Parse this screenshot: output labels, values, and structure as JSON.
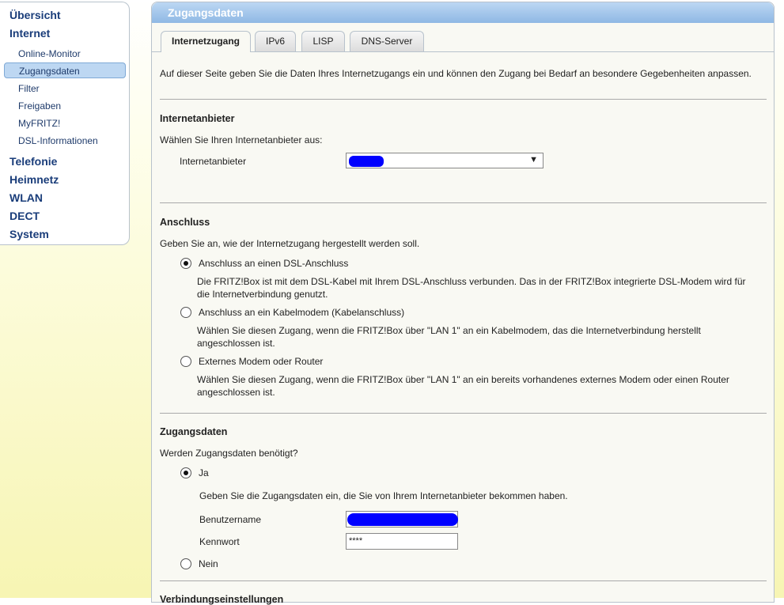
{
  "sidebar": {
    "main_top": [
      "Übersicht",
      "Internet"
    ],
    "sub": [
      "Online-Monitor",
      "Zugangsdaten",
      "Filter",
      "Freigaben",
      "MyFRITZ!",
      "DSL-Informationen"
    ],
    "main_bottom": [
      "Telefonie",
      "Heimnetz",
      "WLAN",
      "DECT",
      "System"
    ]
  },
  "page": {
    "title": "Zugangsdaten",
    "tabs": [
      "Internetzugang",
      "IPv6",
      "LISP",
      "DNS-Server"
    ],
    "intro": "Auf dieser Seite geben Sie die Daten Ihres Internetzugangs ein und können den Zugang bei Bedarf an besondere Gegebenheiten anpassen."
  },
  "provider": {
    "title": "Internetanbieter",
    "prompt": "Wählen Sie Ihren Internetanbieter aus:",
    "label": "Internetanbieter"
  },
  "connection": {
    "title": "Anschluss",
    "prompt": "Geben Sie an, wie der Internetzugang hergestellt werden soll.",
    "options": [
      {
        "label": "Anschluss an einen DSL-Anschluss",
        "desc": "Die FRITZ!Box ist mit dem DSL-Kabel mit Ihrem DSL-Anschluss verbunden. Das in der FRITZ!Box integrierte DSL-Modem wird für die Internetverbindung genutzt."
      },
      {
        "label": "Anschluss an ein Kabelmodem (Kabelanschluss)",
        "desc": "Wählen Sie diesen Zugang, wenn die FRITZ!Box über \"LAN 1\" an ein Kabelmodem, das die Internetverbindung herstellt angeschlossen ist."
      },
      {
        "label": "Externes Modem oder Router",
        "desc": "Wählen Sie diesen Zugang, wenn die FRITZ!Box über \"LAN 1\" an ein bereits vorhandenes externes Modem oder einen Router angeschlossen ist."
      }
    ]
  },
  "credentials": {
    "title": "Zugangsdaten",
    "prompt": "Werden Zugangsdaten benötigt?",
    "yes": "Ja",
    "hint": "Geben Sie die Zugangsdaten ein, die Sie von Ihrem Internetanbieter bekommen haben.",
    "username_label": "Benutzername",
    "password_label": "Kennwort",
    "password_value": "****",
    "no": "Nein"
  },
  "next_section": {
    "title": "Verbindungseinstellungen"
  },
  "colors": {
    "redaction": "#0000ff",
    "header": "#8fb8e4",
    "nav_text": "#1a3d7a"
  }
}
